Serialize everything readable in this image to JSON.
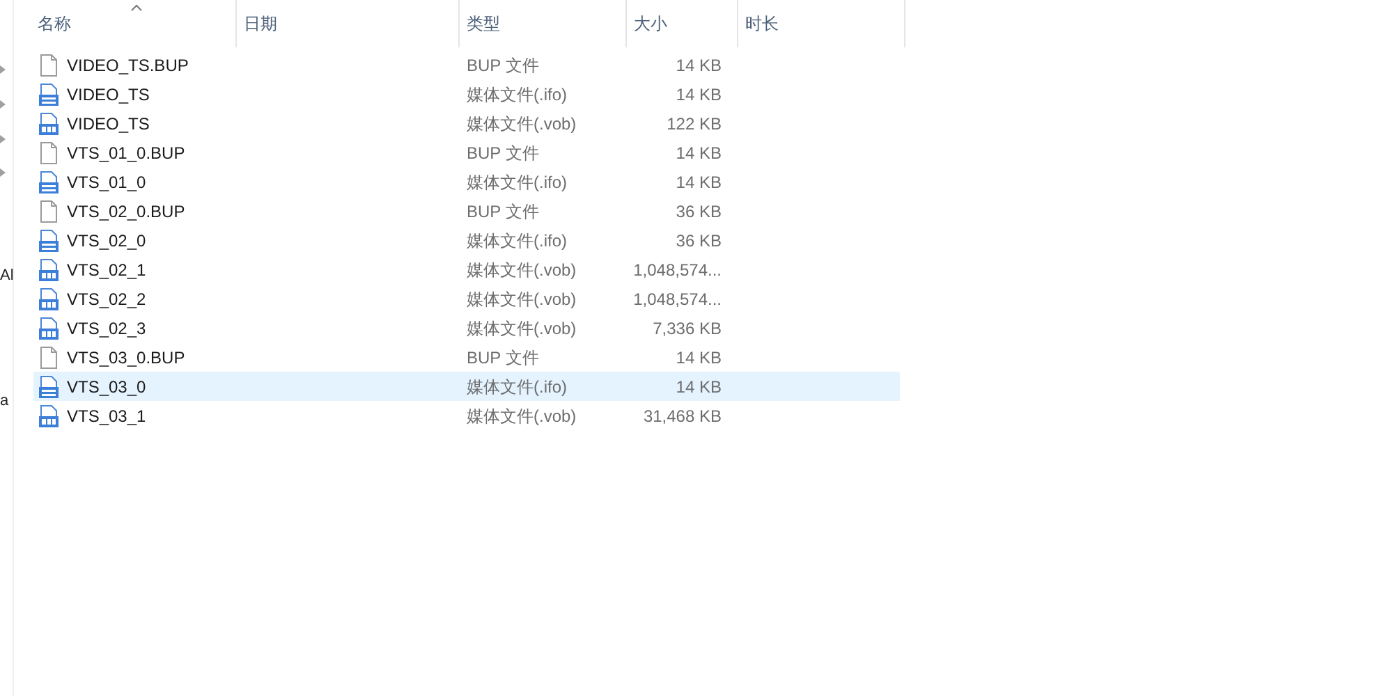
{
  "nav_pane": {
    "items": [
      "Al",
      "a"
    ]
  },
  "columns": [
    {
      "label": "名称",
      "sorted": true
    },
    {
      "label": "日期",
      "sorted": false
    },
    {
      "label": "类型",
      "sorted": false
    },
    {
      "label": "大小",
      "sorted": false
    },
    {
      "label": "时长",
      "sorted": false
    }
  ],
  "rows": [
    {
      "name": "VIDEO_TS.BUP",
      "kind": "bup",
      "type": "BUP 文件",
      "size": "14 KB",
      "selected": false
    },
    {
      "name": "VIDEO_TS",
      "kind": "ifo",
      "type": "媒体文件(.ifo)",
      "size": "14 KB",
      "selected": false
    },
    {
      "name": "VIDEO_TS",
      "kind": "vob",
      "type": "媒体文件(.vob)",
      "size": "122 KB",
      "selected": false
    },
    {
      "name": "VTS_01_0.BUP",
      "kind": "bup",
      "type": "BUP 文件",
      "size": "14 KB",
      "selected": false
    },
    {
      "name": "VTS_01_0",
      "kind": "ifo",
      "type": "媒体文件(.ifo)",
      "size": "14 KB",
      "selected": false
    },
    {
      "name": "VTS_02_0.BUP",
      "kind": "bup",
      "type": "BUP 文件",
      "size": "36 KB",
      "selected": false
    },
    {
      "name": "VTS_02_0",
      "kind": "ifo",
      "type": "媒体文件(.ifo)",
      "size": "36 KB",
      "selected": false
    },
    {
      "name": "VTS_02_1",
      "kind": "vob",
      "type": "媒体文件(.vob)",
      "size": "1,048,574...",
      "selected": false
    },
    {
      "name": "VTS_02_2",
      "kind": "vob",
      "type": "媒体文件(.vob)",
      "size": "1,048,574...",
      "selected": false
    },
    {
      "name": "VTS_02_3",
      "kind": "vob",
      "type": "媒体文件(.vob)",
      "size": "7,336 KB",
      "selected": false
    },
    {
      "name": "VTS_03_0.BUP",
      "kind": "bup",
      "type": "BUP 文件",
      "size": "14 KB",
      "selected": false
    },
    {
      "name": "VTS_03_0",
      "kind": "ifo",
      "type": "媒体文件(.ifo)",
      "size": "14 KB",
      "selected": true
    },
    {
      "name": "VTS_03_1",
      "kind": "vob",
      "type": "媒体文件(.vob)",
      "size": "31,468 KB",
      "selected": false
    }
  ]
}
